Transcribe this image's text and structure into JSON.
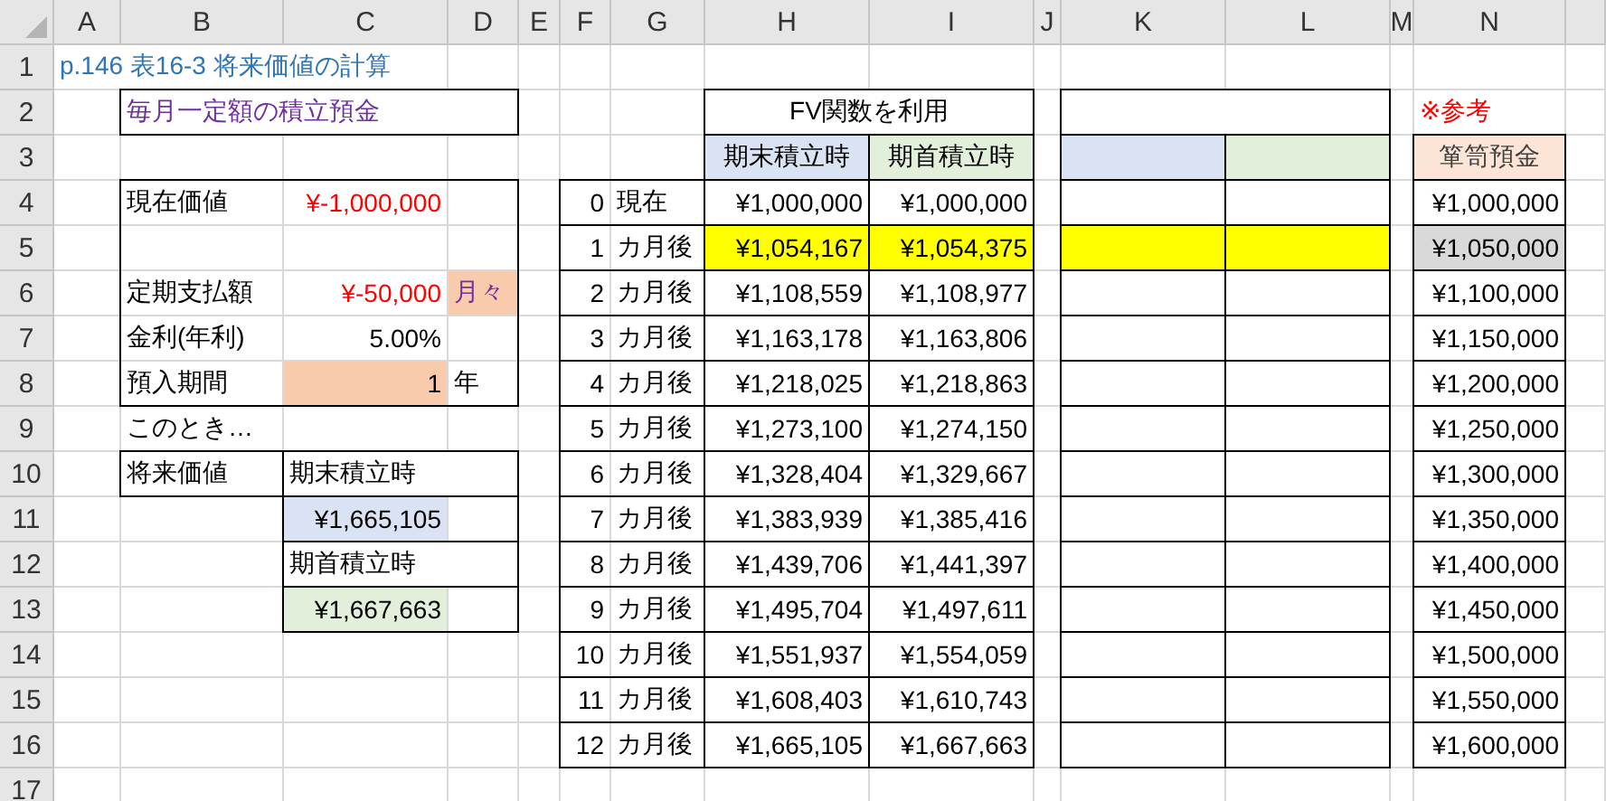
{
  "columns": [
    "A",
    "B",
    "C",
    "D",
    "E",
    "F",
    "G",
    "H",
    "I",
    "J",
    "K",
    "L",
    "M",
    "N"
  ],
  "rows": [
    {
      "number": "1",
      "cells": [
        {
          "text": "p.146 表16-3 将来価値の計算",
          "ink": {
            "color": "#2e75b6"
          },
          "merged_with_next": true
        },
        {
          "merged_with_next": true
        },
        {}
      ]
    },
    {
      "number": "2",
      "cells": [
        {},
        {
          "text": "毎月一定額の積立預金",
          "ink": {
            "color": "#7030a0"
          },
          "merged_with_next": true,
          "top": true,
          "bottom": true,
          "left": true
        },
        {
          "merged_with_next": true,
          "top": true,
          "bottom": true
        },
        {
          "top": true,
          "bottom": true,
          "right": true
        },
        {},
        {},
        {},
        {
          "text": "FV関数を利用",
          "kind": "heading",
          "merged_with_next": true,
          "top": true,
          "bottom": true,
          "left": true
        },
        {
          "top": true,
          "bottom": true,
          "right": true
        },
        {},
        {
          "merged_with_next": true,
          "top": true,
          "bottom": true,
          "left": true
        },
        {
          "top": true,
          "bottom": true,
          "right": true
        },
        {},
        {
          "text": "※参考",
          "ink": {
            "color": "#ff0000"
          }
        }
      ]
    },
    {
      "number": "3",
      "cells": [
        {},
        {},
        {},
        {},
        {},
        {},
        {},
        {
          "text": "期末積立時",
          "kind": "heading",
          "fill": {
            "color": "#dae3f3"
          },
          "top": true,
          "right": true,
          "bottom": true,
          "left": true
        },
        {
          "text": "期首積立時",
          "kind": "heading",
          "fill": {
            "color": "#e2efda"
          },
          "top": true,
          "right": true,
          "bottom": true,
          "left": true
        },
        {},
        {
          "fill": {
            "color": "#dae3f3"
          },
          "top": true,
          "right": true,
          "bottom": true,
          "left": true
        },
        {
          "fill": {
            "color": "#e2efda"
          },
          "top": true,
          "right": true,
          "bottom": true,
          "left": true
        },
        {},
        {
          "text": "箪笥預金",
          "kind": "heading",
          "fill": {
            "color": "#fce4d6"
          },
          "ink": {
            "color": "#404040"
          },
          "top": true,
          "right": true,
          "bottom": true,
          "left": true
        }
      ]
    },
    {
      "number": "4",
      "cells": [
        {},
        {
          "text": "現在価値",
          "top": true,
          "left": true
        },
        {
          "text": "¥-1,000,000",
          "kind": "number",
          "ink": {
            "color": "#ff0000"
          },
          "top": true
        },
        {
          "top": true,
          "right": true
        },
        {},
        {
          "text": "0",
          "kind": "number",
          "top": true,
          "bottom": true,
          "left": true
        },
        {
          "text": "現在",
          "top": true,
          "bottom": true,
          "right": true
        },
        {
          "text": "¥1,000,000",
          "kind": "number",
          "top": true,
          "right": true,
          "bottom": true,
          "left": true
        },
        {
          "text": "¥1,000,000",
          "kind": "number",
          "top": true,
          "right": true,
          "bottom": true,
          "left": true
        },
        {},
        {
          "top": true,
          "right": true,
          "bottom": true,
          "left": true
        },
        {
          "top": true,
          "right": true,
          "bottom": true,
          "left": true
        },
        {},
        {
          "text": "¥1,000,000",
          "kind": "number",
          "top": true,
          "right": true,
          "bottom": true,
          "left": true
        }
      ]
    },
    {
      "number": "5",
      "cells": [
        {},
        {
          "left": true
        },
        {},
        {
          "right": true
        },
        {},
        {
          "text": "1",
          "kind": "number",
          "top": true,
          "bottom": true,
          "left": true
        },
        {
          "text": "カ月後",
          "top": true,
          "bottom": true,
          "right": true
        },
        {
          "text": "¥1,054,167",
          "kind": "number",
          "fill": {
            "color": "#ffff00"
          },
          "top": true,
          "right": true,
          "bottom": true,
          "left": true
        },
        {
          "text": "¥1,054,375",
          "kind": "number",
          "fill": {
            "color": "#ffff00"
          },
          "top": true,
          "right": true,
          "bottom": true,
          "left": true
        },
        {},
        {
          "fill": {
            "color": "#ffff00"
          },
          "top": true,
          "right": true,
          "bottom": true,
          "left": true
        },
        {
          "fill": {
            "color": "#ffff00"
          },
          "top": true,
          "right": true,
          "bottom": true,
          "left": true
        },
        {},
        {
          "text": "¥1,050,000",
          "kind": "number",
          "fill": {
            "color": "#d9d9d9"
          },
          "top": true,
          "right": true,
          "bottom": true,
          "left": true
        }
      ]
    },
    {
      "number": "6",
      "cells": [
        {},
        {
          "text": "定期支払額",
          "left": true
        },
        {
          "text": "¥-50,000",
          "kind": "number",
          "ink": {
            "color": "#ff0000"
          }
        },
        {
          "text": "月々",
          "ink": {
            "color": "#7030a0"
          },
          "fill": {
            "color": "#f8cbad"
          },
          "right": true
        },
        {},
        {
          "text": "2",
          "kind": "number",
          "top": true,
          "bottom": true,
          "left": true
        },
        {
          "text": "カ月後",
          "top": true,
          "bottom": true,
          "right": true
        },
        {
          "text": "¥1,108,559",
          "kind": "number",
          "top": true,
          "right": true,
          "bottom": true,
          "left": true
        },
        {
          "text": "¥1,108,977",
          "kind": "number",
          "top": true,
          "right": true,
          "bottom": true,
          "left": true
        },
        {},
        {
          "top": true,
          "right": true,
          "bottom": true,
          "left": true
        },
        {
          "top": true,
          "right": true,
          "bottom": true,
          "left": true
        },
        {},
        {
          "text": "¥1,100,000",
          "kind": "number",
          "top": true,
          "right": true,
          "bottom": true,
          "left": true
        }
      ]
    },
    {
      "number": "7",
      "cells": [
        {},
        {
          "text": "金利(年利)",
          "left": true
        },
        {
          "text": "5.00%",
          "kind": "number"
        },
        {
          "right": true
        },
        {},
        {
          "text": "3",
          "kind": "number",
          "top": true,
          "bottom": true,
          "left": true
        },
        {
          "text": "カ月後",
          "top": true,
          "bottom": true,
          "right": true
        },
        {
          "text": "¥1,163,178",
          "kind": "number",
          "top": true,
          "right": true,
          "bottom": true,
          "left": true
        },
        {
          "text": "¥1,163,806",
          "kind": "number",
          "top": true,
          "right": true,
          "bottom": true,
          "left": true
        },
        {},
        {
          "top": true,
          "right": true,
          "bottom": true,
          "left": true
        },
        {
          "top": true,
          "right": true,
          "bottom": true,
          "left": true
        },
        {},
        {
          "text": "¥1,150,000",
          "kind": "number",
          "top": true,
          "right": true,
          "bottom": true,
          "left": true
        }
      ]
    },
    {
      "number": "8",
      "cells": [
        {},
        {
          "text": "預入期間",
          "left": true,
          "bottom": true
        },
        {
          "text": "1",
          "kind": "number",
          "fill": {
            "color": "#f8cbad"
          },
          "bottom": true
        },
        {
          "text": "年",
          "right": true,
          "bottom": true
        },
        {},
        {
          "text": "4",
          "kind": "number",
          "top": true,
          "bottom": true,
          "left": true
        },
        {
          "text": "カ月後",
          "top": true,
          "bottom": true,
          "right": true
        },
        {
          "text": "¥1,218,025",
          "kind": "number",
          "top": true,
          "right": true,
          "bottom": true,
          "left": true
        },
        {
          "text": "¥1,218,863",
          "kind": "number",
          "top": true,
          "right": true,
          "bottom": true,
          "left": true
        },
        {},
        {
          "top": true,
          "right": true,
          "bottom": true,
          "left": true
        },
        {
          "top": true,
          "right": true,
          "bottom": true,
          "left": true
        },
        {},
        {
          "text": "¥1,200,000",
          "kind": "number",
          "top": true,
          "right": true,
          "bottom": true,
          "left": true
        }
      ]
    },
    {
      "number": "9",
      "cells": [
        {},
        {
          "text": "このとき…"
        },
        {},
        {},
        {},
        {
          "text": "5",
          "kind": "number",
          "top": true,
          "bottom": true,
          "left": true
        },
        {
          "text": "カ月後",
          "top": true,
          "bottom": true,
          "right": true
        },
        {
          "text": "¥1,273,100",
          "kind": "number",
          "top": true,
          "right": true,
          "bottom": true,
          "left": true
        },
        {
          "text": "¥1,274,150",
          "kind": "number",
          "top": true,
          "right": true,
          "bottom": true,
          "left": true
        },
        {},
        {
          "top": true,
          "right": true,
          "bottom": true,
          "left": true
        },
        {
          "top": true,
          "right": true,
          "bottom": true,
          "left": true
        },
        {},
        {
          "text": "¥1,250,000",
          "kind": "number",
          "top": true,
          "right": true,
          "bottom": true,
          "left": true
        }
      ]
    },
    {
      "number": "10",
      "cells": [
        {},
        {
          "text": "将来価値",
          "top": true,
          "right": true,
          "bottom": true,
          "left": true
        },
        {
          "text": "期末積立時",
          "merged_with_next": true,
          "top": true,
          "bottom": true,
          "left": true
        },
        {
          "top": true,
          "bottom": true,
          "right": true
        },
        {},
        {
          "text": "6",
          "kind": "number",
          "top": true,
          "bottom": true,
          "left": true
        },
        {
          "text": "カ月後",
          "top": true,
          "bottom": true,
          "right": true
        },
        {
          "text": "¥1,328,404",
          "kind": "number",
          "top": true,
          "right": true,
          "bottom": true,
          "left": true
        },
        {
          "text": "¥1,329,667",
          "kind": "number",
          "top": true,
          "right": true,
          "bottom": true,
          "left": true
        },
        {},
        {
          "top": true,
          "right": true,
          "bottom": true,
          "left": true
        },
        {
          "top": true,
          "right": true,
          "bottom": true,
          "left": true
        },
        {},
        {
          "text": "¥1,300,000",
          "kind": "number",
          "top": true,
          "right": true,
          "bottom": true,
          "left": true
        }
      ]
    },
    {
      "number": "11",
      "cells": [
        {},
        {},
        {
          "text": "¥1,665,105",
          "kind": "number",
          "fill": {
            "color": "#dae3f3"
          },
          "top": true,
          "bottom": true,
          "left": true
        },
        {
          "top": true,
          "bottom": true,
          "right": true
        },
        {},
        {
          "text": "7",
          "kind": "number",
          "top": true,
          "bottom": true,
          "left": true
        },
        {
          "text": "カ月後",
          "top": true,
          "bottom": true,
          "right": true
        },
        {
          "text": "¥1,383,939",
          "kind": "number",
          "top": true,
          "right": true,
          "bottom": true,
          "left": true
        },
        {
          "text": "¥1,385,416",
          "kind": "number",
          "top": true,
          "right": true,
          "bottom": true,
          "left": true
        },
        {},
        {
          "top": true,
          "right": true,
          "bottom": true,
          "left": true
        },
        {
          "top": true,
          "right": true,
          "bottom": true,
          "left": true
        },
        {},
        {
          "text": "¥1,350,000",
          "kind": "number",
          "top": true,
          "right": true,
          "bottom": true,
          "left": true
        }
      ]
    },
    {
      "number": "12",
      "cells": [
        {},
        {},
        {
          "text": "期首積立時",
          "merged_with_next": true,
          "top": true,
          "bottom": true,
          "left": true
        },
        {
          "top": true,
          "bottom": true,
          "right": true
        },
        {},
        {
          "text": "8",
          "kind": "number",
          "top": true,
          "bottom": true,
          "left": true
        },
        {
          "text": "カ月後",
          "top": true,
          "bottom": true,
          "right": true
        },
        {
          "text": "¥1,439,706",
          "kind": "number",
          "top": true,
          "right": true,
          "bottom": true,
          "left": true
        },
        {
          "text": "¥1,441,397",
          "kind": "number",
          "top": true,
          "right": true,
          "bottom": true,
          "left": true
        },
        {},
        {
          "top": true,
          "right": true,
          "bottom": true,
          "left": true
        },
        {
          "top": true,
          "right": true,
          "bottom": true,
          "left": true
        },
        {},
        {
          "text": "¥1,400,000",
          "kind": "number",
          "top": true,
          "right": true,
          "bottom": true,
          "left": true
        }
      ]
    },
    {
      "number": "13",
      "cells": [
        {},
        {},
        {
          "text": "¥1,667,663",
          "kind": "number",
          "fill": {
            "color": "#e2efda"
          },
          "top": true,
          "bottom": true,
          "left": true
        },
        {
          "top": true,
          "bottom": true,
          "right": true
        },
        {},
        {
          "text": "9",
          "kind": "number",
          "top": true,
          "bottom": true,
          "left": true
        },
        {
          "text": "カ月後",
          "top": true,
          "bottom": true,
          "right": true
        },
        {
          "text": "¥1,495,704",
          "kind": "number",
          "top": true,
          "right": true,
          "bottom": true,
          "left": true
        },
        {
          "text": "¥1,497,611",
          "kind": "number",
          "top": true,
          "right": true,
          "bottom": true,
          "left": true
        },
        {},
        {
          "top": true,
          "right": true,
          "bottom": true,
          "left": true
        },
        {
          "top": true,
          "right": true,
          "bottom": true,
          "left": true
        },
        {},
        {
          "text": "¥1,450,000",
          "kind": "number",
          "top": true,
          "right": true,
          "bottom": true,
          "left": true
        }
      ]
    },
    {
      "number": "14",
      "cells": [
        {},
        {},
        {},
        {},
        {},
        {
          "text": "10",
          "kind": "number",
          "top": true,
          "bottom": true,
          "left": true
        },
        {
          "text": "カ月後",
          "top": true,
          "bottom": true,
          "right": true
        },
        {
          "text": "¥1,551,937",
          "kind": "number",
          "top": true,
          "right": true,
          "bottom": true,
          "left": true
        },
        {
          "text": "¥1,554,059",
          "kind": "number",
          "top": true,
          "right": true,
          "bottom": true,
          "left": true
        },
        {},
        {
          "top": true,
          "right": true,
          "bottom": true,
          "left": true
        },
        {
          "top": true,
          "right": true,
          "bottom": true,
          "left": true
        },
        {},
        {
          "text": "¥1,500,000",
          "kind": "number",
          "top": true,
          "right": true,
          "bottom": true,
          "left": true
        }
      ]
    },
    {
      "number": "15",
      "cells": [
        {},
        {},
        {},
        {},
        {},
        {
          "text": "11",
          "kind": "number",
          "top": true,
          "bottom": true,
          "left": true
        },
        {
          "text": "カ月後",
          "top": true,
          "bottom": true,
          "right": true
        },
        {
          "text": "¥1,608,403",
          "kind": "number",
          "top": true,
          "right": true,
          "bottom": true,
          "left": true
        },
        {
          "text": "¥1,610,743",
          "kind": "number",
          "top": true,
          "right": true,
          "bottom": true,
          "left": true
        },
        {},
        {
          "top": true,
          "right": true,
          "bottom": true,
          "left": true
        },
        {
          "top": true,
          "right": true,
          "bottom": true,
          "left": true
        },
        {},
        {
          "text": "¥1,550,000",
          "kind": "number",
          "top": true,
          "right": true,
          "bottom": true,
          "left": true
        }
      ]
    },
    {
      "number": "16",
      "cells": [
        {},
        {},
        {},
        {},
        {},
        {
          "text": "12",
          "kind": "number",
          "top": true,
          "bottom": true,
          "left": true
        },
        {
          "text": "カ月後",
          "top": true,
          "bottom": true,
          "right": true
        },
        {
          "text": "¥1,665,105",
          "kind": "number",
          "top": true,
          "right": true,
          "bottom": true,
          "left": true
        },
        {
          "text": "¥1,667,663",
          "kind": "number",
          "top": true,
          "right": true,
          "bottom": true,
          "left": true
        },
        {},
        {
          "top": true,
          "right": true,
          "bottom": true,
          "left": true
        },
        {
          "top": true,
          "right": true,
          "bottom": true,
          "left": true
        },
        {},
        {
          "text": "¥1,600,000",
          "kind": "number",
          "top": true,
          "right": true,
          "bottom": true,
          "left": true
        }
      ]
    },
    {
      "number": "17"
    }
  ]
}
